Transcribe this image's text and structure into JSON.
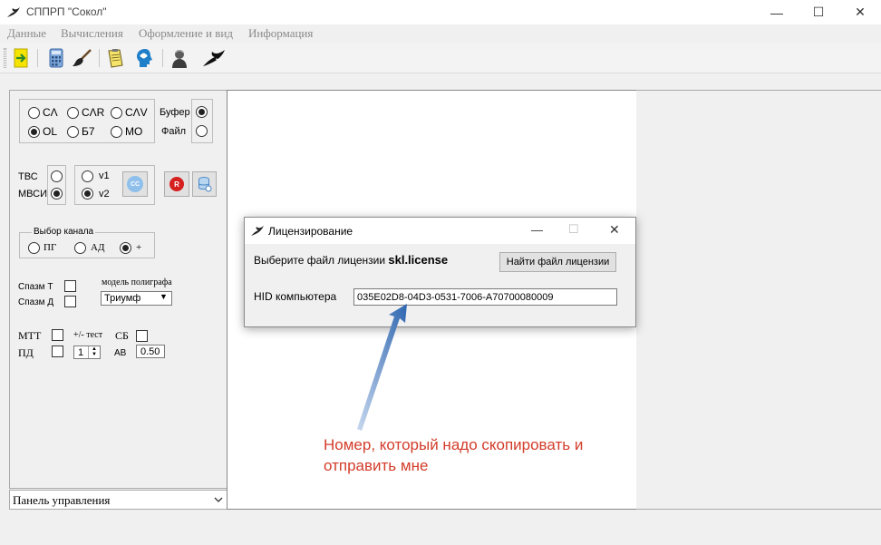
{
  "window": {
    "title": "СППРП \"Сокол\"",
    "controls": [
      "—",
      "☐",
      "✕"
    ]
  },
  "menu": [
    "Данные",
    "Вычисления",
    "Оформление и вид",
    "Информация"
  ],
  "toolbar": {
    "icons": [
      "exit-arrow-icon",
      "calculator-icon",
      "brush-icon",
      "notepad-icon",
      "brain-head-icon",
      "person-icon",
      "falcon-icon"
    ]
  },
  "left_panel": {
    "mode_radios": [
      {
        "label": "CΛ",
        "checked": false
      },
      {
        "label": "CΛR",
        "checked": false
      },
      {
        "label": "CΛV",
        "checked": false
      },
      {
        "label": "OL",
        "checked": true
      },
      {
        "label": "Б7",
        "checked": false
      },
      {
        "label": "MO",
        "checked": false
      }
    ],
    "source": [
      {
        "label": "Буфер",
        "checked": true
      },
      {
        "label": "Файл",
        "checked": false
      }
    ],
    "method": [
      {
        "label": "ТВС",
        "checked": false
      },
      {
        "label": "МВСИ",
        "checked": true
      }
    ],
    "version": [
      {
        "label": "v1",
        "checked": false
      },
      {
        "label": "v2",
        "checked": true
      }
    ],
    "buttons": {
      "cc": "CC",
      "r": "R"
    },
    "channel": {
      "title": "Выбор канала",
      "options": [
        {
          "label": "ПГ",
          "checked": false
        },
        {
          "label": "АД",
          "checked": false
        },
        {
          "label": "+",
          "checked": true
        }
      ]
    },
    "spasm_t": "Спазм Т",
    "spasm_d": "Спазм Д",
    "poly_model_label": "модель полиграфа",
    "poly_model_value": "Триумф",
    "mtt": "МТТ",
    "test": "+/- тест",
    "sb": "СБ",
    "pd": "ПД",
    "stepper_value": "1",
    "ab_label": "АВ",
    "ab_value": "0.50"
  },
  "bottom_combo": {
    "value": "Панель управления"
  },
  "dialog": {
    "title": "Лицензирование",
    "controls": [
      "—",
      "☐",
      "✕"
    ],
    "prompt_prefix": "Выберите файл лицензии",
    "file_name": "skl.license",
    "find_button": "Найти файл лицензии",
    "hid_label": "HID компьютера",
    "hid_value": "035E02D8-04D3-0531-7006-A70700080009"
  },
  "annotation": {
    "line1": "Номер, который надо скопировать и",
    "line2": "отправить мне",
    "arrow_color": "#3f74b8",
    "text_color": "#d33c2a"
  }
}
